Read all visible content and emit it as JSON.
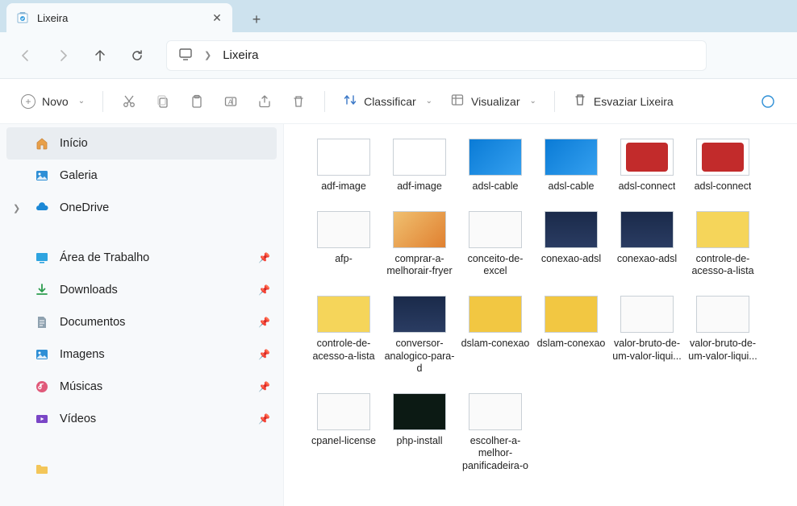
{
  "tab": {
    "title": "Lixeira"
  },
  "breadcrumb": {
    "location": "Lixeira"
  },
  "toolbar": {
    "new_label": "Novo",
    "sort_label": "Classificar",
    "view_label": "Visualizar",
    "empty_label": "Esvaziar Lixeira"
  },
  "sidebar": {
    "top": [
      {
        "label": "Início",
        "icon": "home",
        "selected": true
      },
      {
        "label": "Galeria",
        "icon": "gallery",
        "selected": false
      },
      {
        "label": "OneDrive",
        "icon": "onedrive",
        "selected": false,
        "expandable": true
      }
    ],
    "libs": [
      {
        "label": "Área de Trabalho",
        "icon": "desktop"
      },
      {
        "label": "Downloads",
        "icon": "downloads"
      },
      {
        "label": "Documentos",
        "icon": "documents"
      },
      {
        "label": "Imagens",
        "icon": "pictures"
      },
      {
        "label": "Músicas",
        "icon": "music"
      },
      {
        "label": "Vídeos",
        "icon": "videos"
      }
    ]
  },
  "files": {
    "row1": [
      {
        "name": "adf-image",
        "cls": "th-box"
      },
      {
        "name": "adf-image",
        "cls": "th-box"
      },
      {
        "name": "adsl-cable",
        "cls": "th-blue"
      },
      {
        "name": "adsl-cable",
        "cls": "th-blue"
      },
      {
        "name": "adsl-connect",
        "cls": "th-red"
      },
      {
        "name": "adsl-connect",
        "cls": "th-red"
      },
      {
        "name": "afp-",
        "cls": "th-white"
      }
    ],
    "row2": [
      {
        "name": "comprar-a-melhorair-fryer",
        "cls": "th-food"
      },
      {
        "name": "conceito-de-excel",
        "cls": "th-white"
      },
      {
        "name": "conexao-adsl",
        "cls": "th-dark"
      },
      {
        "name": "conexao-adsl",
        "cls": "th-dark"
      },
      {
        "name": "controle-de-acesso-a-lista",
        "cls": "th-panel"
      },
      {
        "name": "controle-de-acesso-a-lista",
        "cls": "th-panel"
      },
      {
        "name": "conversor-analogico-para-d",
        "cls": "th-dark"
      }
    ],
    "row3": [
      {
        "name": "dslam-conexao",
        "cls": "th-yel"
      },
      {
        "name": "dslam-conexao",
        "cls": "th-yel"
      },
      {
        "name": "valor-bruto-de-um-valor-liqui...",
        "cls": "th-white"
      },
      {
        "name": "valor-bruto-de-um-valor-liqui...",
        "cls": "th-white"
      },
      {
        "name": "cpanel-license",
        "cls": "th-white"
      },
      {
        "name": "php-install",
        "cls": "th-term"
      },
      {
        "name": "escolher-a-melhor-panificadeira-o",
        "cls": "th-white"
      }
    ]
  }
}
